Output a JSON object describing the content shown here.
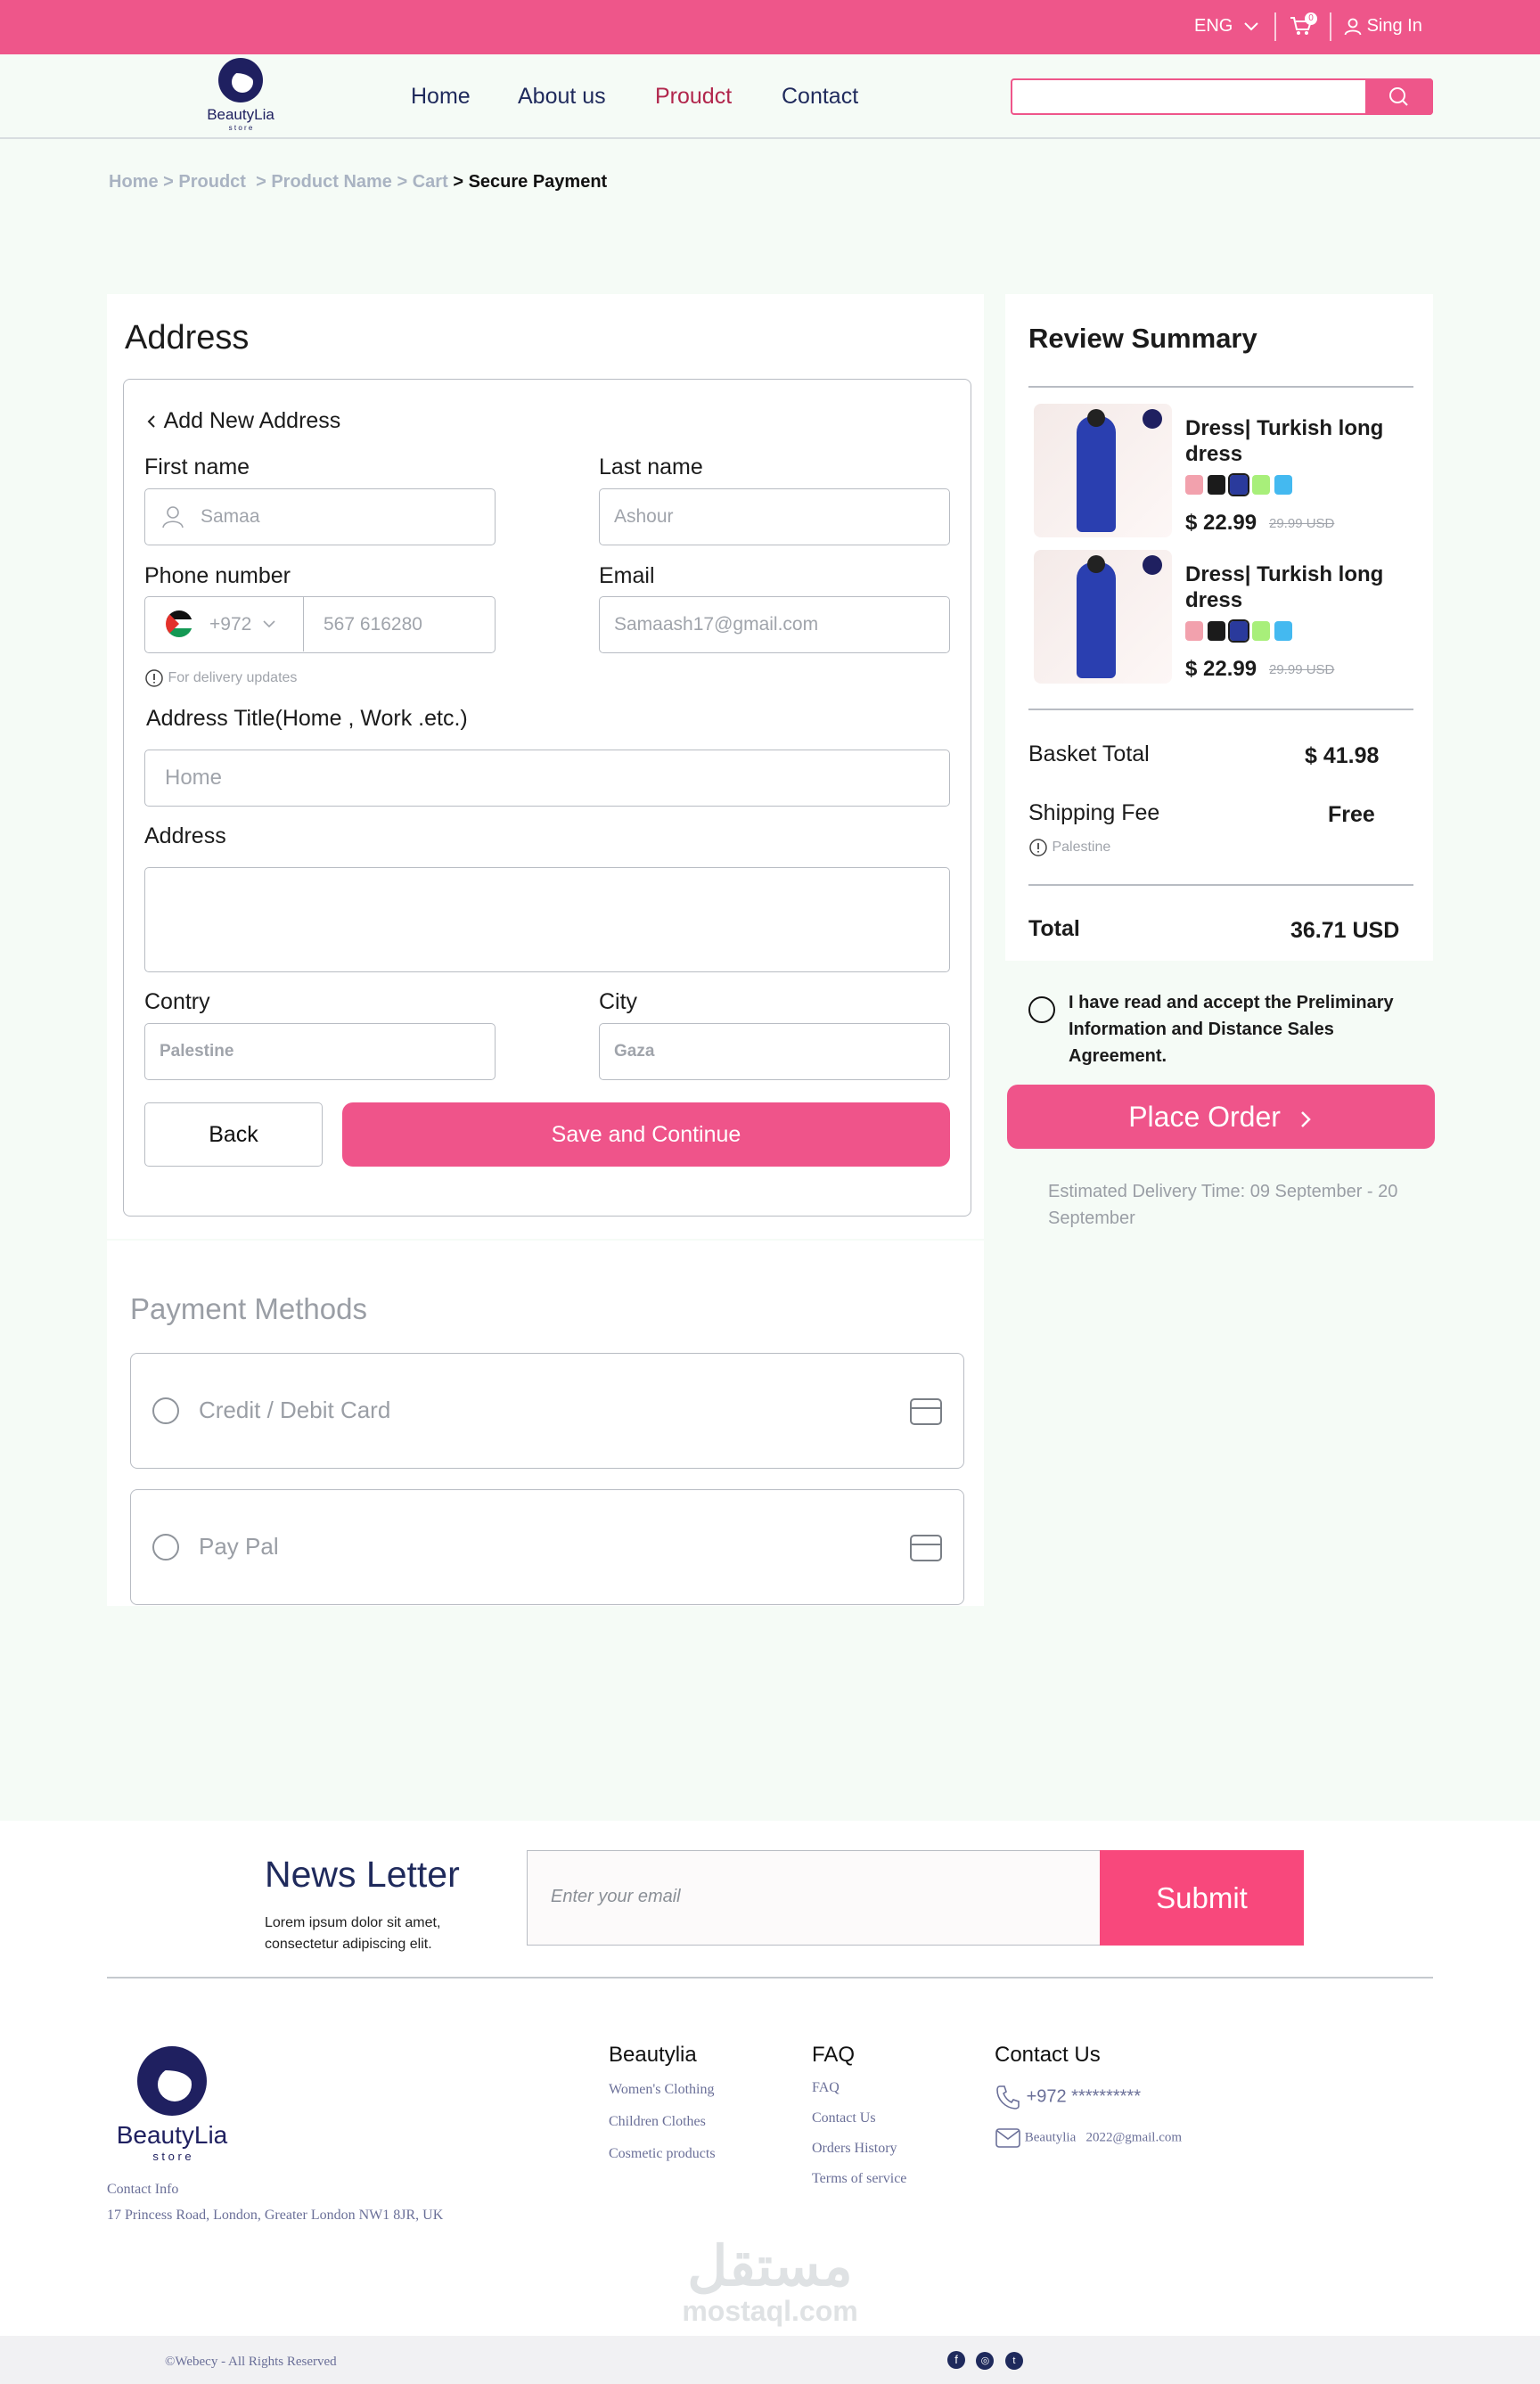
{
  "topbar": {
    "language": "ENG",
    "cart_count": "0",
    "signin": "Sing In"
  },
  "logo": {
    "name": "BeautyLia",
    "sub": "s t o r e"
  },
  "nav": {
    "home": "Home",
    "about": "About us",
    "product": "Proudct",
    "contact": "Contact"
  },
  "breadcrumb": {
    "home": "Home",
    "product": "Proudct",
    "product_name": "Product Name",
    "cart": "Cart",
    "current": "Secure Payment",
    "sep": ">"
  },
  "address": {
    "title": "Address",
    "add_new": "Add New Address",
    "first_name_label": "First name",
    "first_name_value": "Samaa",
    "last_name_label": "Last name",
    "last_name_value": "Ashour",
    "phone_label": "Phone number",
    "phone_code": "+972",
    "phone_value": "567 616280",
    "email_label": "Email",
    "email_value": "Samaash17@gmail.com",
    "phone_hint": "For delivery updates",
    "address_title_label": "Address Title(Home , Work .etc.)",
    "address_title_value": "Home",
    "address_label": "Address",
    "country_label": "Contry",
    "country_value": "Palestine",
    "city_label": "City",
    "city_value": "Gaza",
    "back": "Back",
    "save": "Save and Continue"
  },
  "payment": {
    "title": "Payment Methods",
    "options": [
      {
        "label": "Credit / Debit Card",
        "icon": "credit-card-icon"
      },
      {
        "label": "Pay Pal",
        "icon": "credit-card-icon"
      }
    ]
  },
  "summary": {
    "title": "Review Summary",
    "items": [
      {
        "name": "Dress| Turkish long dress",
        "price": "$ 22.99",
        "old_price": "29.99 USD",
        "colors": [
          "#f2a1ad",
          "#1b1b1b",
          "#2a3a9c",
          "#a8ef7a",
          "#44b9f0"
        ]
      },
      {
        "name": "Dress| Turkish long dress",
        "price": "$ 22.99",
        "old_price": "29.99 USD",
        "colors": [
          "#f2a1ad",
          "#1b1b1b",
          "#2a3a9c",
          "#a8ef7a",
          "#44b9f0"
        ]
      }
    ],
    "basket_label": "Basket Total",
    "basket_value": "$ 41.98",
    "shipping_label": "Shipping Fee",
    "shipping_value": "Free",
    "shipping_note": "Palestine",
    "total_label": "Total",
    "total_value": "36.71 USD",
    "agree": "I have read and accept the Preliminary Information and Distance Sales Agreement.",
    "place_order": "Place Order",
    "delivery": "Estimated Delivery Time: 09 September - 20 September"
  },
  "newsletter": {
    "title": "News Letter",
    "text": "Lorem ipsum dolor sit amet, consectetur adipiscing elit.",
    "placeholder": "Enter your email",
    "submit": "Submit"
  },
  "footer": {
    "contact_info": "Contact Info",
    "address": "17 Princess Road, London, Greater London NW1 8JR, UK",
    "col1_title": "Beautylia",
    "col1_links": [
      "Women's Clothing",
      "Children Clothes",
      "Cosmetic products"
    ],
    "col2_title": "FAQ",
    "col2_links": [
      "FAQ",
      "Contact Us",
      "Orders History",
      "Terms of service"
    ],
    "col3_title": "Contact Us",
    "phone": "+972 **********",
    "email_name": "Beautylia",
    "email": "2022@gmail.com",
    "copyright": "©Webecy - All Rights Reserved"
  },
  "watermark": {
    "arabic": "مستقل",
    "latin": "mostaql.com"
  },
  "colors": {
    "brand_pink": "#ee568a",
    "navy": "#1f2a5c",
    "active_nav": "#b1264c"
  }
}
